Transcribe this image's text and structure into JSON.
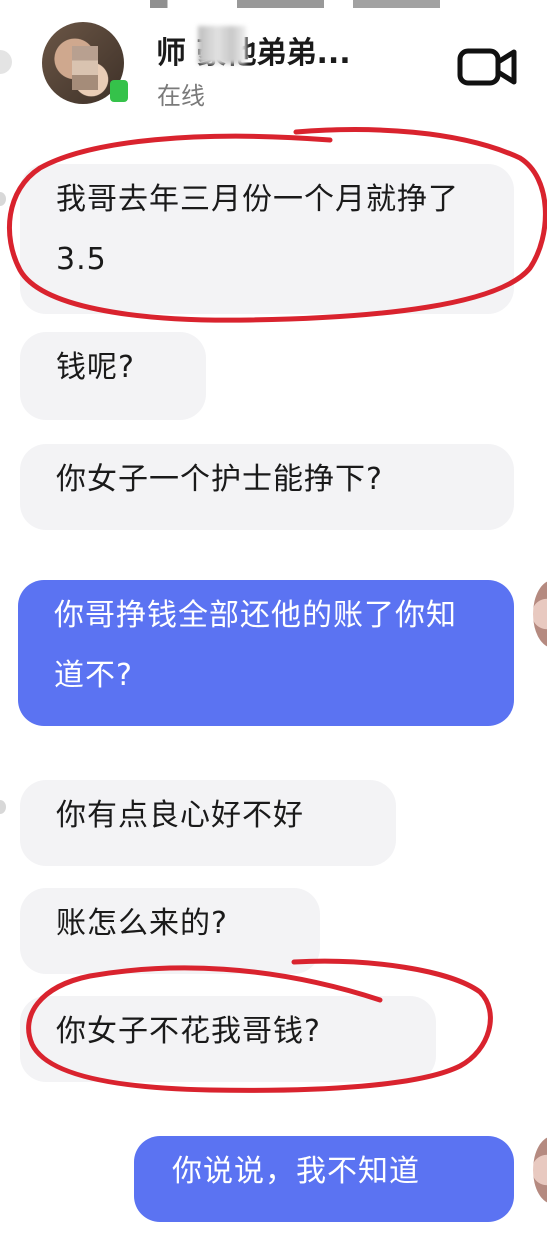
{
  "header": {
    "contact_name": "师    豪他弟弟...",
    "status": "在线",
    "video_icon": "video-camera-icon"
  },
  "messages": [
    {
      "side": "in",
      "text": "我哥去年三月份一个月就挣了 3.5"
    },
    {
      "side": "in",
      "text": "钱呢?"
    },
    {
      "side": "in",
      "text": "你女子一个护士能挣下?"
    },
    {
      "side": "out",
      "text": "你哥挣钱全部还他的账了你知道不?"
    },
    {
      "side": "in",
      "text": "你有点良心好不好"
    },
    {
      "side": "in",
      "text": "账怎么来的?"
    },
    {
      "side": "in",
      "text": "你女子不花我哥钱?"
    },
    {
      "side": "out",
      "text": "你说说，我不知道"
    }
  ],
  "colors": {
    "outgoing_bubble": "#5b73f2",
    "incoming_bubble": "#f3f3f5",
    "annotation": "#d9232e",
    "online": "#35c24a"
  }
}
